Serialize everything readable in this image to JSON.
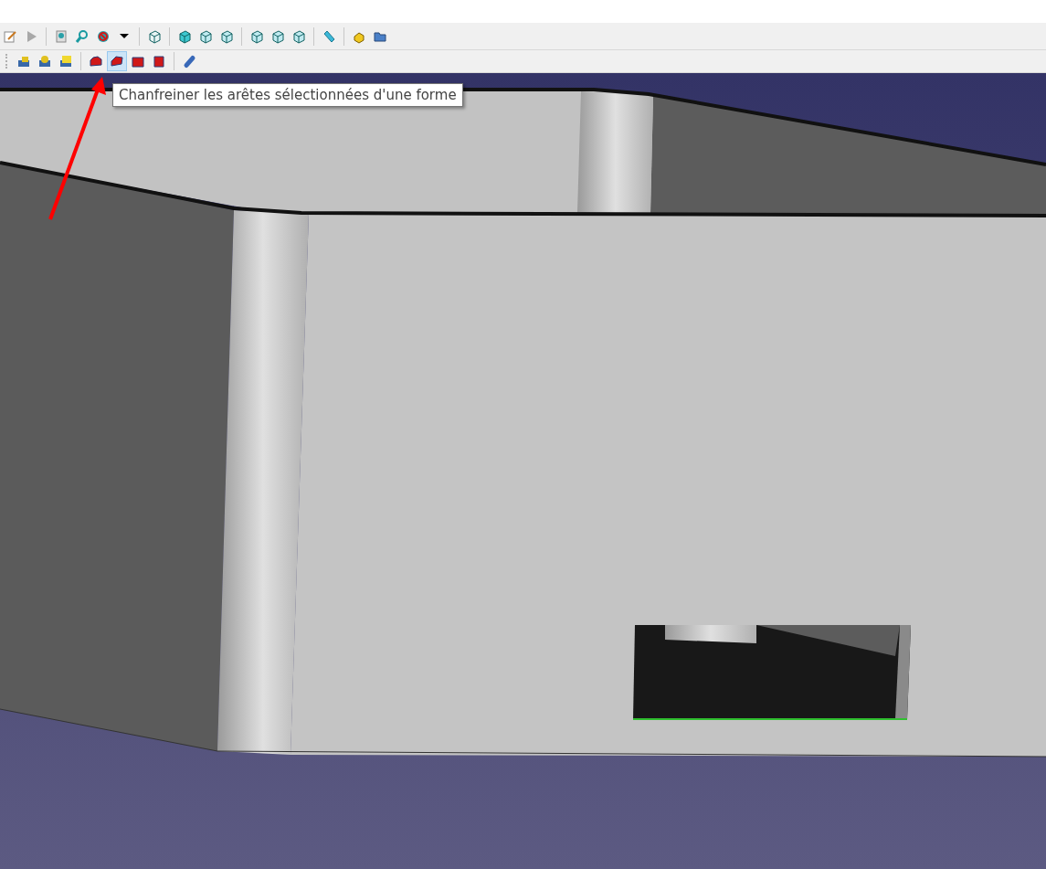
{
  "toolbars": [
    {
      "groups": [
        {
          "buttons": [
            {
              "kind": "edit",
              "highlighted": false
            },
            {
              "kind": "play",
              "highlighted": false
            }
          ]
        },
        {
          "buttons": [
            {
              "kind": "fit",
              "highlighted": false
            },
            {
              "kind": "zoom",
              "highlighted": false
            },
            {
              "kind": "style",
              "highlighted": false
            },
            {
              "kind": "caret",
              "highlighted": false
            }
          ]
        },
        {
          "buttons": [
            {
              "kind": "iso",
              "highlighted": false
            }
          ]
        },
        {
          "buttons": [
            {
              "kind": "front",
              "highlighted": false
            },
            {
              "kind": "top",
              "highlighted": false
            },
            {
              "kind": "right",
              "highlighted": false
            }
          ]
        },
        {
          "buttons": [
            {
              "kind": "rear",
              "highlighted": false
            },
            {
              "kind": "bottom",
              "highlighted": false
            },
            {
              "kind": "left",
              "highlighted": false
            }
          ]
        },
        {
          "buttons": [
            {
              "kind": "measure",
              "highlighted": false
            }
          ]
        },
        {
          "buttons": [
            {
              "kind": "part",
              "highlighted": false
            },
            {
              "kind": "folder",
              "highlighted": false
            }
          ]
        }
      ]
    },
    {
      "groups": [
        {
          "buttons": [
            {
              "kind": "boolean",
              "highlighted": false
            },
            {
              "kind": "cut",
              "highlighted": false
            },
            {
              "kind": "fuse",
              "highlighted": false
            }
          ]
        },
        {
          "buttons": [
            {
              "kind": "fillet",
              "highlighted": false
            },
            {
              "kind": "chamfer",
              "highlighted": true
            },
            {
              "kind": "face",
              "highlighted": false
            },
            {
              "kind": "thickness",
              "highlighted": false
            }
          ]
        },
        {
          "buttons": [
            {
              "kind": "cylinder",
              "highlighted": false
            }
          ]
        }
      ]
    }
  ],
  "tooltip": {
    "text": "Chanfreiner les arêtes sélectionnées d'une forme"
  }
}
